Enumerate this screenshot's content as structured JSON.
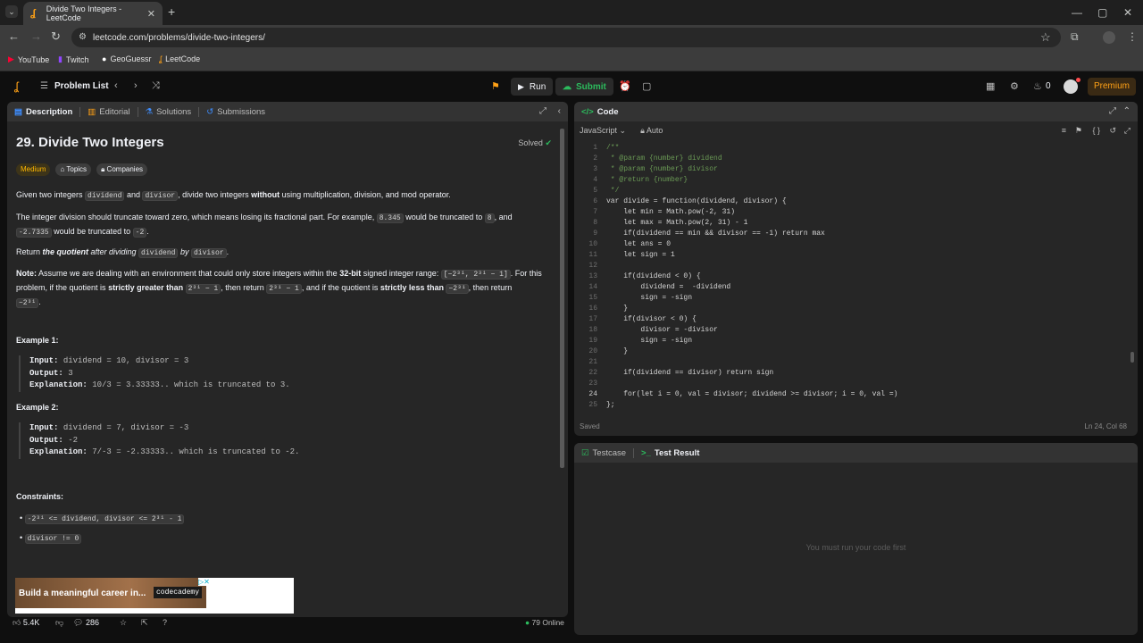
{
  "browser": {
    "tab_title": "Divide Two Integers - LeetCode",
    "url": "leetcode.com/problems/divide-two-integers/",
    "bookmarks": [
      "YouTube",
      "Twitch",
      "GeoGuessr",
      "LeetCode"
    ]
  },
  "nav": {
    "problem_list": "Problem List",
    "run": "Run",
    "submit": "Submit",
    "streak": "0",
    "premium": "Premium"
  },
  "left_tabs": [
    "Description",
    "Editorial",
    "Solutions",
    "Submissions"
  ],
  "problem": {
    "title": "29. Divide Two Integers",
    "status": "Solved",
    "difficulty": "Medium",
    "topics": "Topics",
    "companies": "Companies",
    "p1_pre": "Given two integers ",
    "p1_c1": "dividend",
    "p1_mid": " and ",
    "p1_c2": "divisor",
    "p1_mid2": ", divide two integers ",
    "p1_b": "without",
    "p1_post": " using multiplication, division, and mod operator.",
    "p2_a": "The integer division should truncate toward zero, which means losing its fractional part. For example, ",
    "p2_c1": "8.345",
    "p2_b": " would be truncated to ",
    "p2_c2": "8",
    "p2_c": ", and",
    "p2_c3": "-2.7335",
    "p2_d": " would be truncated to ",
    "p2_c4": "-2",
    "p2_e": ".",
    "p3_a": "Return ",
    "p3_b": "the quotient",
    "p3_c": " after dividing ",
    "p3_c1": "dividend",
    "p3_d": " by ",
    "p3_c2": "divisor",
    "p3_e": ".",
    "note_b": "Note:",
    "note_a": " Assume we are dealing with an environment that could only store integers within the ",
    "note_bit": "32-bit",
    "note_c": " signed integer range: ",
    "note_range": "[−2³¹, 2³¹ − 1]",
    "note_d": ". For this problem, if the quotient is ",
    "note_sg": "strictly greater than",
    "note_c2": "2³¹ − 1",
    "note_e": ", then return ",
    "note_c3": "2³¹ − 1",
    "note_f": ", and if the quotient is ",
    "note_sl": "strictly less than",
    "note_c4": "−2³¹",
    "note_g": ", then return",
    "note_c5": "−2³¹",
    "note_h": "."
  },
  "examples": [
    {
      "title": "Example 1:",
      "input_label": "Input:",
      "input": "dividend = 10, divisor = 3",
      "output_label": "Output:",
      "output": "3",
      "expl_label": "Explanation:",
      "explanation": "10/3 = 3.33333.. which is truncated to 3."
    },
    {
      "title": "Example 2:",
      "input_label": "Input:",
      "input": "dividend = 7, divisor = -3",
      "output_label": "Output:",
      "output": "-2",
      "expl_label": "Explanation:",
      "explanation": "7/-3 = -2.33333.. which is truncated to -2."
    }
  ],
  "constraints": {
    "title": "Constraints:",
    "c1": "-2³¹ <= dividend, divisor <= 2³¹ - 1",
    "c2": "divisor != 0"
  },
  "ad": {
    "text": "Build a meaningful career in...",
    "logo": "codecademy"
  },
  "footer": {
    "likes": "5.4K",
    "comments": "286",
    "online": "79 Online"
  },
  "code": {
    "title": "Code",
    "language": "JavaScript",
    "mode": "Auto",
    "saved": "Saved",
    "cursor": "Ln 24, Col 68",
    "lines": [
      "/**",
      " * @param {number} dividend",
      " * @param {number} divisor",
      " * @return {number}",
      " */",
      "var divide = function(dividend, divisor) {",
      "    let min = Math.pow(-2, 31)",
      "    let max = Math.pow(2, 31) - 1",
      "    if(dividend == min && divisor == -1) return max",
      "    let ans = 0",
      "    let sign = 1",
      "",
      "    if(dividend < 0) {",
      "        dividend =  -dividend",
      "        sign = -sign",
      "    }",
      "    if(divisor < 0) {",
      "        divisor = -divisor",
      "        sign = -sign",
      "    }",
      "",
      "    if(dividend == divisor) return sign",
      "",
      "    for(let i = 0, val = divisor; dividend >= divisor; i = 0, val =)",
      "};"
    ]
  },
  "result": {
    "tab1": "Testcase",
    "tab2": "Test Result",
    "empty": "You must run your code first"
  }
}
